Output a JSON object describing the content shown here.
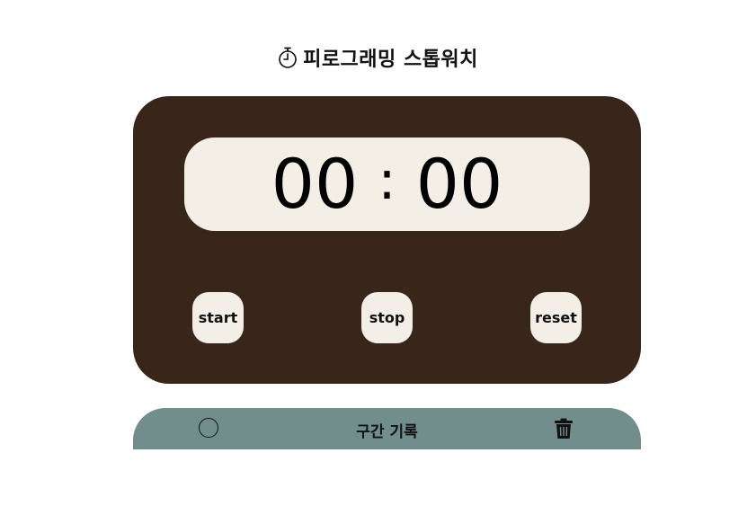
{
  "header": {
    "title": "피로그래밍 스톱워치",
    "icon": "stopwatch-icon"
  },
  "display": {
    "seconds": "00",
    "separator": ":",
    "centiseconds": "00"
  },
  "controls": {
    "start_label": "start",
    "stop_label": "stop",
    "reset_label": "reset"
  },
  "laps": {
    "title": "구간 기록",
    "select_all_icon": "circle-icon",
    "delete_icon": "trash-icon"
  },
  "colors": {
    "card_bg": "#39261b",
    "display_bg": "#f3efe7",
    "lap_bar_bg": "#718e8d"
  }
}
